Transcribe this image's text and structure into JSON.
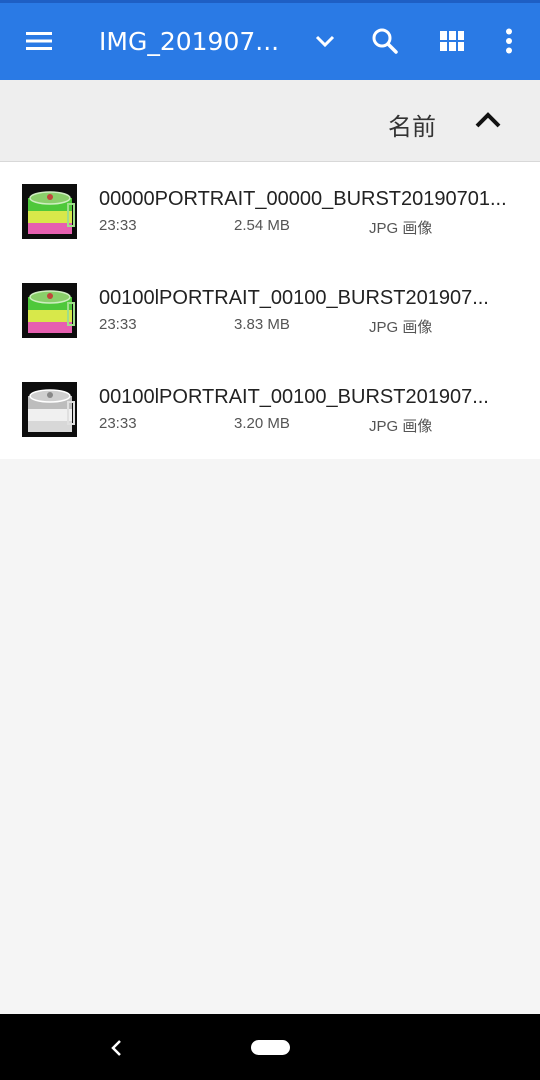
{
  "colors": {
    "appbar": "#2a7ae5",
    "sortbar": "#eeeeee",
    "list_bg": "#ffffff",
    "page_bg": "#f5f5f5",
    "navbar": "#000000"
  },
  "appbar": {
    "menu_icon": "hamburger-menu-icon",
    "title": "IMG_201907...",
    "dropdown_icon": "chevron-down-icon",
    "search_icon": "search-icon",
    "grid_icon": "grid-view-icon",
    "more_icon": "more-vert-icon"
  },
  "sortbar": {
    "label": "名前",
    "direction_icon": "chevron-up-icon"
  },
  "files": [
    {
      "name": "00000PORTRAIT_00000_BURST20190701...",
      "time": "23:33",
      "size": "2.54 MB",
      "type": "JPG 画像",
      "thumbnail": "color"
    },
    {
      "name": "00100lPORTRAIT_00100_BURST201907...",
      "time": "23:33",
      "size": "3.83 MB",
      "type": "JPG 画像",
      "thumbnail": "color"
    },
    {
      "name": "00100lPORTRAIT_00100_BURST201907...",
      "time": "23:33",
      "size": "3.20 MB",
      "type": "JPG 画像",
      "thumbnail": "grayscale"
    }
  ],
  "navbar": {
    "back_icon": "back-chevron-icon",
    "home_icon": "home-pill-icon"
  }
}
